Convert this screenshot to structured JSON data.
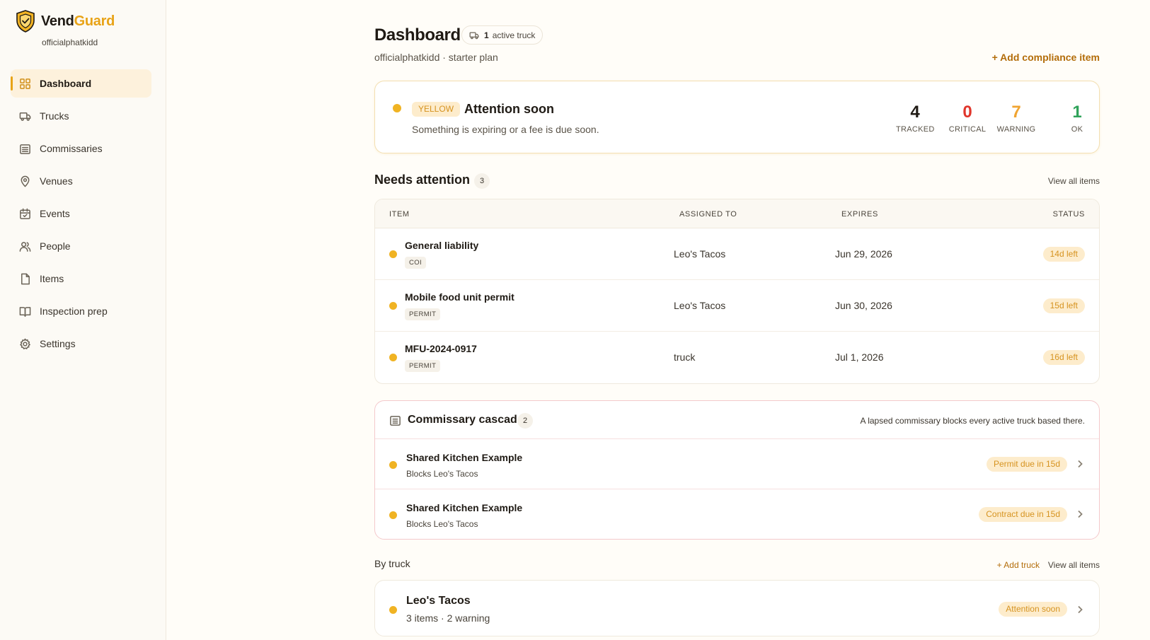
{
  "brand": {
    "name_part1": "Vend",
    "name_part2": "Guard",
    "username": "officialphatkidd",
    "accent": "#e8a317"
  },
  "sidebar": {
    "items": [
      {
        "label": "Dashboard",
        "icon": "grid-icon",
        "active": true
      },
      {
        "label": "Trucks",
        "icon": "truck-icon"
      },
      {
        "label": "Commissaries",
        "icon": "building-icon"
      },
      {
        "label": "Venues",
        "icon": "map-pin-icon"
      },
      {
        "label": "Events",
        "icon": "calendar-icon"
      },
      {
        "label": "People",
        "icon": "users-icon"
      },
      {
        "label": "Items",
        "icon": "file-icon"
      },
      {
        "label": "Inspection prep",
        "icon": "book-icon"
      },
      {
        "label": "Settings",
        "icon": "gear-icon"
      }
    ]
  },
  "header": {
    "title": "Dashboard",
    "active_trucks_count": "1",
    "active_trucks_label": "active truck",
    "subtitle": "officialphatkidd · starter plan",
    "add_compliance": "+ Add compliance item"
  },
  "status": {
    "level_tag": "YELLOW",
    "title": "Attention soon",
    "description": "Something is expiring or a fee is due soon.",
    "metrics": [
      {
        "value": "4",
        "label": "TRACKED",
        "color": "#1f1a14"
      },
      {
        "value": "0",
        "label": "CRITICAL",
        "color": "#e0352b"
      },
      {
        "value": "7",
        "label": "WARNING",
        "color": "#f0a431"
      },
      {
        "value": "1",
        "label": "OK",
        "color": "#2fa35a"
      }
    ]
  },
  "needs_attention": {
    "title": "Needs attention",
    "count": "3",
    "view_all": "View all items",
    "columns": [
      "ITEM",
      "ASSIGNED TO",
      "EXPIRES",
      "STATUS"
    ],
    "rows": [
      {
        "name": "General liability",
        "tag": "COI",
        "assigned": "Leo's Tacos",
        "expires": "Jun 29, 2026",
        "status": "14d left"
      },
      {
        "name": "Mobile food unit permit",
        "tag": "PERMIT",
        "assigned": "Leo's Tacos",
        "expires": "Jun 30, 2026",
        "status": "15d left"
      },
      {
        "name": "MFU-2024-0917",
        "tag": "PERMIT",
        "assigned": "truck",
        "expires": "Jul 1, 2026",
        "status": "16d left"
      }
    ]
  },
  "cascade": {
    "title": "Commissary cascade",
    "count": "2",
    "note": "A lapsed commissary blocks every active truck based there.",
    "rows": [
      {
        "name": "Shared Kitchen Example",
        "blocks": "Blocks Leo's Tacos",
        "status": "Permit due in 15d"
      },
      {
        "name": "Shared Kitchen Example",
        "blocks": "Blocks Leo's Tacos",
        "status": "Contract due in 15d"
      }
    ]
  },
  "by_truck": {
    "title": "By truck",
    "add_truck": "+ Add truck",
    "view_all": "View all items",
    "trucks": [
      {
        "name": "Leo's Tacos",
        "meta": "3 items · 2 warning",
        "status": "Attention soon"
      }
    ]
  }
}
